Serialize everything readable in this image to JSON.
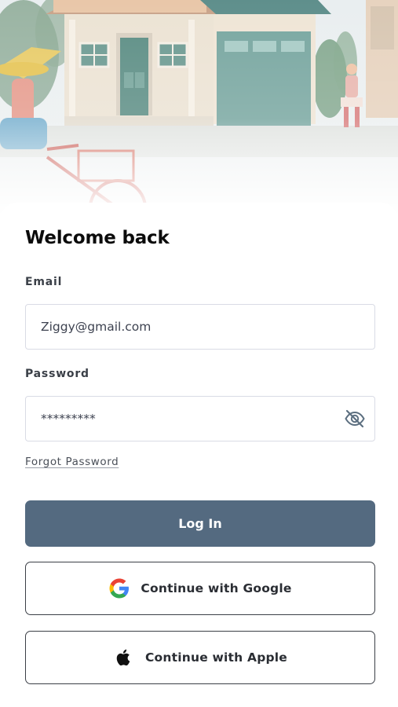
{
  "header": {
    "title": "Welcome back"
  },
  "form": {
    "email_label": "Email",
    "email_value": "Ziggy@gmail.com",
    "password_label": "Password",
    "password_value": "*********",
    "forgot_label": "Forgot Password"
  },
  "actions": {
    "login_label": "Log In",
    "google_label": "Continue with Google",
    "apple_label": "Continue with Apple"
  },
  "icons": {
    "password_toggle": "eye-slash-icon",
    "google": "google-logo-icon",
    "apple": "apple-logo-icon"
  },
  "colors": {
    "primary_button": "#546a80",
    "field_border": "#d9dbe5",
    "social_border": "#3b3f46"
  }
}
